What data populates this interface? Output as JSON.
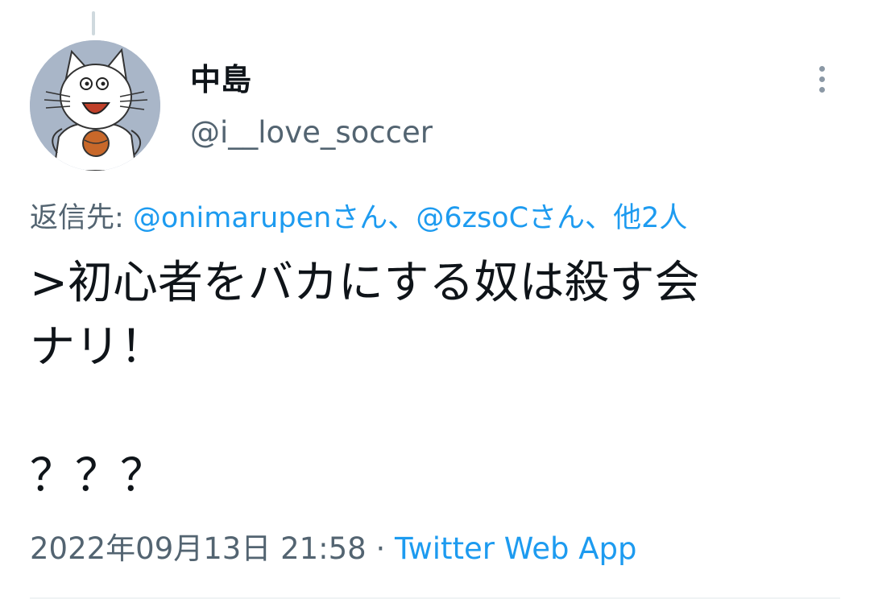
{
  "author": {
    "display_name": "中島",
    "handle": "@i__love_soccer"
  },
  "reply": {
    "prefix": "返信先: ",
    "mention_1": "@onimarupenさん",
    "separator_1": "、",
    "mention_2": "@6zsoCさん",
    "separator_2": "、",
    "others": "他2人"
  },
  "tweet": {
    "line_1": ">初心者をバカにする奴は殺す会",
    "line_2": "ナリ！",
    "line_3": "？？？"
  },
  "meta": {
    "timestamp": "2022年09月13日 21:58",
    "dot": " · ",
    "source": "Twitter Web App"
  },
  "icons": {
    "more": "more-vertical-icon",
    "avatar": "cartoon-cat-avatar"
  },
  "colors": {
    "link": "#1d9bf0",
    "text": "#0f1419",
    "secondary": "#536471"
  }
}
